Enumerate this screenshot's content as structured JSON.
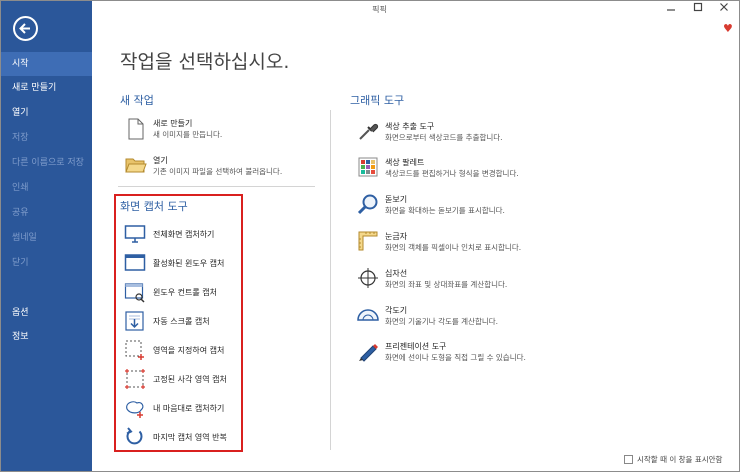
{
  "window": {
    "title": "픽픽"
  },
  "sidebar": {
    "items": [
      {
        "label": "시작",
        "state": "active"
      },
      {
        "label": "새로 만들기",
        "state": "normal"
      },
      {
        "label": "열기",
        "state": "normal"
      },
      {
        "label": "저장",
        "state": "disabled"
      },
      {
        "label": "다른 이름으로 저장",
        "state": "disabled"
      },
      {
        "label": "인쇄",
        "state": "disabled"
      },
      {
        "label": "공유",
        "state": "disabled"
      },
      {
        "label": "썸네일",
        "state": "disabled"
      },
      {
        "label": "닫기",
        "state": "disabled"
      },
      {
        "label": "옵션",
        "state": "normal"
      },
      {
        "label": "정보",
        "state": "normal"
      }
    ]
  },
  "main": {
    "title": "작업을 선택하십시오.",
    "new_task": {
      "heading": "새 작업",
      "items": [
        {
          "title": "새로 만들기",
          "desc": "새 이미지를 만듭니다.",
          "icon": "new-document-icon"
        },
        {
          "title": "열기",
          "desc": "기존 이미지 파일을 선택하여 불러옵니다.",
          "icon": "open-folder-icon"
        }
      ]
    },
    "capture": {
      "heading": "화면 캡처 도구",
      "items": [
        {
          "label": "전체화면 캡처하기",
          "icon": "monitor-icon"
        },
        {
          "label": "활성화된 윈도우 캡처",
          "icon": "active-window-icon"
        },
        {
          "label": "윈도우 컨트롤 캡처",
          "icon": "window-control-icon"
        },
        {
          "label": "자동 스크롤 캡처",
          "icon": "scroll-capture-icon"
        },
        {
          "label": "영역을 지정하여 캡처",
          "icon": "region-capture-icon"
        },
        {
          "label": "고정된 사각 영역 캡처",
          "icon": "fixed-region-icon"
        },
        {
          "label": "내 마음대로 캡처하기",
          "icon": "freehand-capture-icon"
        },
        {
          "label": "마지막 캡처 영역 반복",
          "icon": "repeat-capture-icon"
        }
      ]
    },
    "graphic_tools": {
      "heading": "그래픽 도구",
      "items": [
        {
          "title": "색상 추출 도구",
          "desc": "화면으로부터 색상코드를 추출합니다.",
          "icon": "eyedropper-icon"
        },
        {
          "title": "색상 팔레트",
          "desc": "색상코드를 편집하거나 형식을 변경합니다.",
          "icon": "palette-icon"
        },
        {
          "title": "돋보기",
          "desc": "화면을 확대하는 돋보기를 표시합니다.",
          "icon": "magnifier-icon"
        },
        {
          "title": "눈금자",
          "desc": "화면의 객체를 픽셀이나 인치로 표시합니다.",
          "icon": "ruler-icon"
        },
        {
          "title": "십자선",
          "desc": "화면의 좌표 및 상대좌표를 계산합니다.",
          "icon": "crosshair-icon"
        },
        {
          "title": "각도기",
          "desc": "화면의 기울기나 각도를 계산합니다.",
          "icon": "protractor-icon"
        },
        {
          "title": "프리젠테이션 도구",
          "desc": "화면에 선이나 도형을 직접 그릴 수 있습니다.",
          "icon": "pen-icon"
        }
      ]
    }
  },
  "footer": {
    "checkbox_label": "시작할 때 이 창을 표시안함",
    "checked": false
  },
  "colors": {
    "sidebar": "#2b579a",
    "accent": "#2e5fa3",
    "highlight_box": "#d9201f"
  }
}
